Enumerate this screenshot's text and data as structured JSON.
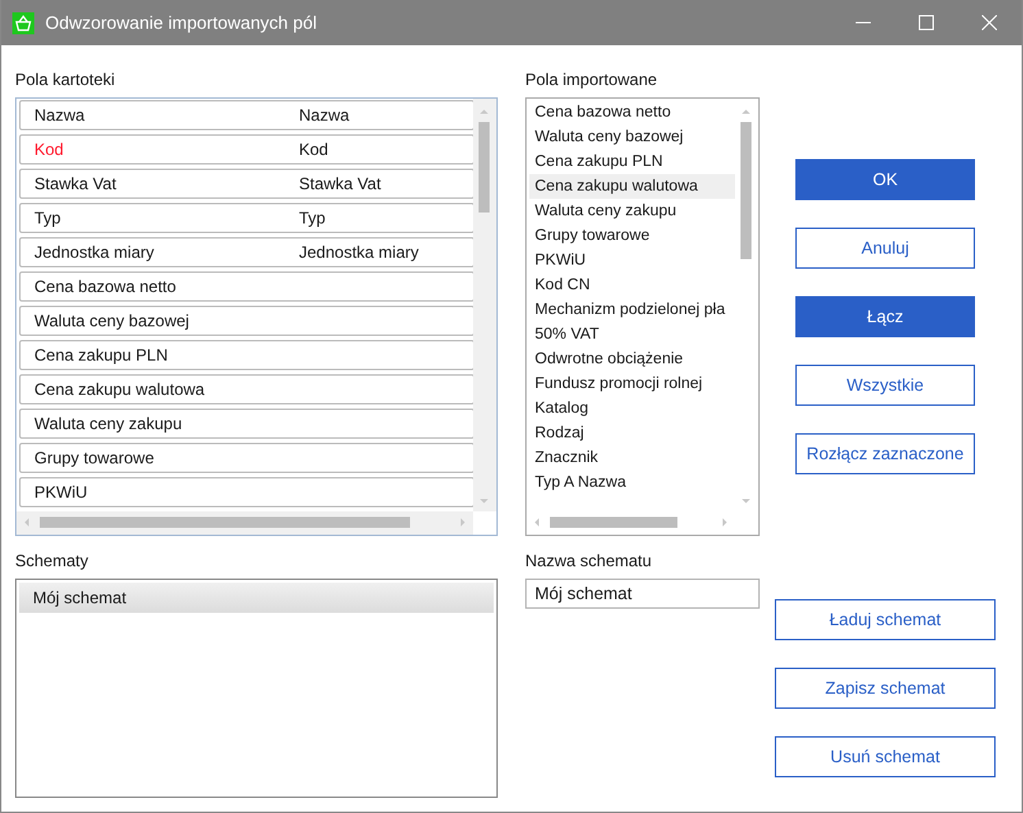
{
  "window": {
    "title": "Odwzorowanie importowanych pól"
  },
  "catalog_fields": {
    "label": "Pola kartoteki",
    "rows": [
      {
        "field": "Nazwa",
        "mapped": "Nazwa",
        "highlighted": false
      },
      {
        "field": "Kod",
        "mapped": "Kod",
        "highlighted": true
      },
      {
        "field": "Stawka Vat",
        "mapped": "Stawka Vat",
        "highlighted": false
      },
      {
        "field": "Typ",
        "mapped": "Typ",
        "highlighted": false
      },
      {
        "field": "Jednostka miary",
        "mapped": "Jednostka miary",
        "highlighted": false
      },
      {
        "field": "Cena bazowa netto",
        "highlighted": false
      },
      {
        "field": "Waluta ceny bazowej",
        "highlighted": false
      },
      {
        "field": "Cena zakupu PLN",
        "highlighted": false
      },
      {
        "field": "Cena zakupu walutowa",
        "highlighted": false
      },
      {
        "field": "Waluta ceny zakupu",
        "highlighted": false
      },
      {
        "field": "Grupy towarowe",
        "highlighted": false
      },
      {
        "field": "PKWiU",
        "highlighted": false
      }
    ]
  },
  "imported_fields": {
    "label": "Pola importowane",
    "items": [
      {
        "label": "Cena bazowa netto",
        "selected": false
      },
      {
        "label": "Waluta ceny bazowej",
        "selected": false
      },
      {
        "label": "Cena zakupu PLN",
        "selected": false
      },
      {
        "label": "Cena zakupu walutowa",
        "selected": true
      },
      {
        "label": "Waluta ceny zakupu",
        "selected": false
      },
      {
        "label": "Grupy towarowe",
        "selected": false
      },
      {
        "label": "PKWiU",
        "selected": false
      },
      {
        "label": "Kod CN",
        "selected": false
      },
      {
        "label": "Mechanizm podzielonej pła",
        "selected": false
      },
      {
        "label": "50% VAT",
        "selected": false
      },
      {
        "label": "Odwrotne obciążenie",
        "selected": false
      },
      {
        "label": "Fundusz promocji rolnej",
        "selected": false
      },
      {
        "label": "Katalog",
        "selected": false
      },
      {
        "label": "Rodzaj",
        "selected": false
      },
      {
        "label": "Znacznik",
        "selected": false
      },
      {
        "label": "Typ A Nazwa",
        "selected": false
      }
    ]
  },
  "actions": [
    {
      "label": "OK",
      "kind": "primary"
    },
    {
      "label": "Anuluj",
      "kind": "secondary"
    },
    {
      "label": "Łącz",
      "kind": "primary"
    },
    {
      "label": "Wszystkie",
      "kind": "secondary"
    },
    {
      "label": "Rozłącz zaznaczone",
      "kind": "secondary"
    }
  ],
  "schemes": {
    "label": "Schematy",
    "items": [
      {
        "label": "Mój schemat",
        "selected": true
      }
    ]
  },
  "scheme_name": {
    "label": "Nazwa schematu",
    "value": "Mój schemat"
  },
  "scheme_actions": [
    {
      "label": "Ładuj schemat"
    },
    {
      "label": "Zapisz schemat"
    },
    {
      "label": "Usuń schemat"
    }
  ]
}
